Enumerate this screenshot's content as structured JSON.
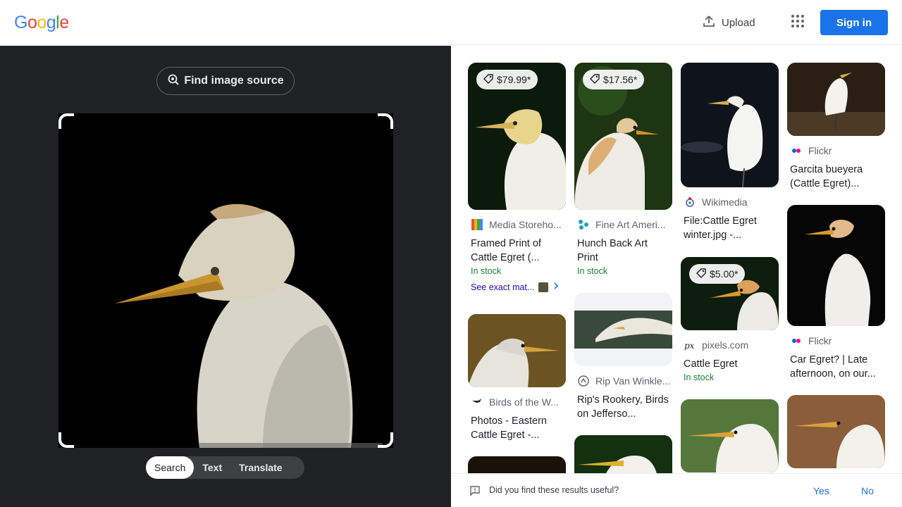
{
  "header": {
    "logo_letters": [
      "G",
      "o",
      "o",
      "g",
      "l",
      "e"
    ],
    "logo_colors": [
      "#4285F4",
      "#EA4335",
      "#FBBC05",
      "#4285F4",
      "#34A853",
      "#EA4335"
    ],
    "upload_label": "Upload",
    "signin_label": "Sign in"
  },
  "left": {
    "find_source_label": "Find image source",
    "modes": [
      "Search",
      "Text",
      "Translate"
    ],
    "active_mode": "Search"
  },
  "results": [
    {
      "price": "$79.99*",
      "source": "Media Storeho...",
      "title": "Framed Print of Cattle Egret (...",
      "stock": "In stock",
      "exact": "See exact mat..."
    },
    {
      "price": "$17.56*",
      "source": "Fine Art Ameri...",
      "title": "Hunch Back Art Print",
      "stock": "In stock"
    },
    {
      "source": "Wikimedia",
      "title": "File:Cattle Egret winter.jpg -..."
    },
    {
      "source": "Flickr",
      "title": "Garcita bueyera (Cattle Egret)..."
    },
    {
      "source": "Birds of the W...",
      "title": "Photos - Eastern Cattle Egret -..."
    },
    {
      "source": "Rip Van Winkle...",
      "title": "Rip's Rookery, Birds on Jefferso..."
    },
    {
      "price": "$5.00*",
      "source": "pixels.com",
      "title": "Cattle Egret",
      "stock": "In stock"
    },
    {
      "source": "Flickr",
      "title": "Car Egret? | Late afternoon, on our..."
    }
  ],
  "feedback": {
    "question": "Did you find these results useful?",
    "yes": "Yes",
    "no": "No"
  },
  "colors": {
    "accent": "#1a73e8",
    "panel_dark": "#202124",
    "in_stock": "#188038"
  }
}
